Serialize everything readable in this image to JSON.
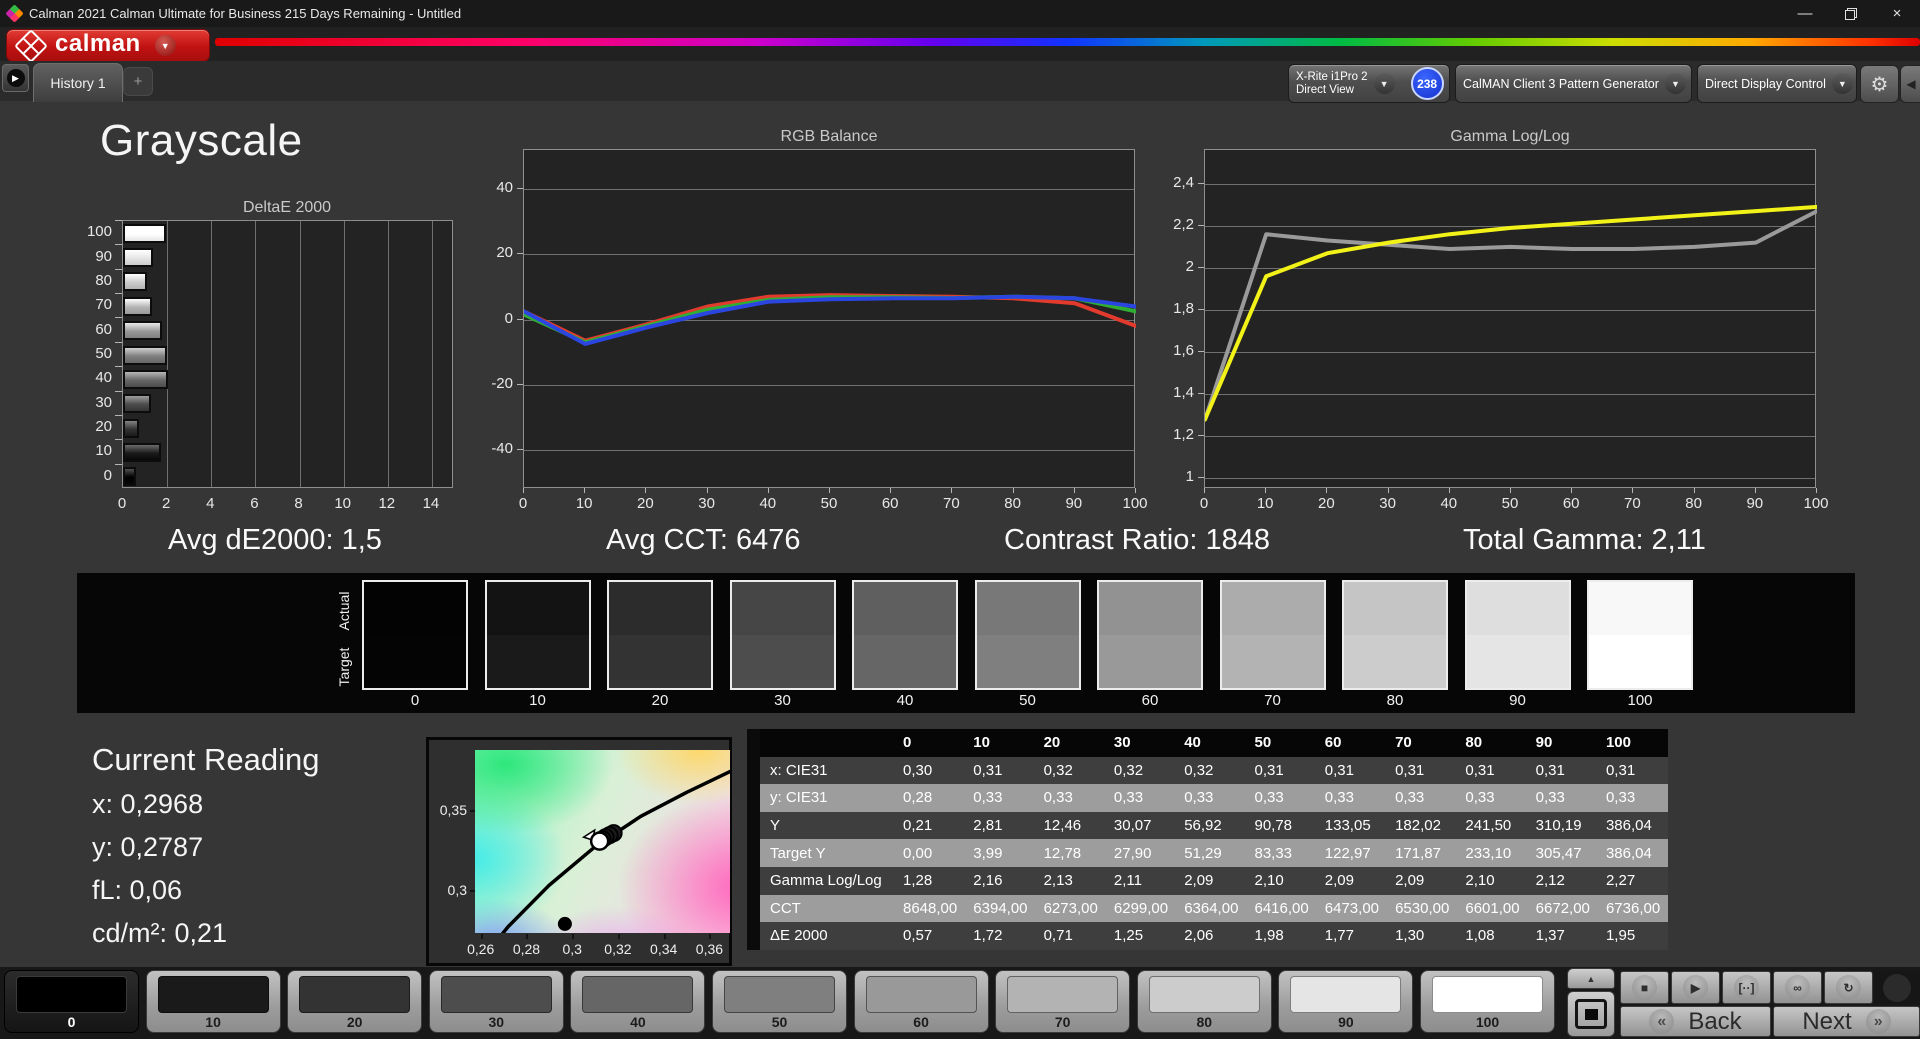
{
  "window": {
    "title": "Calman 2021 Calman Ultimate for Business 215 Days Remaining  - Untitled",
    "controls": [
      "minimize",
      "restore",
      "close"
    ]
  },
  "brand": {
    "logo_text": "calman"
  },
  "tabs": {
    "history": "History 1",
    "add": "+"
  },
  "toolbar": {
    "meter": {
      "line1": "X-Rite i1Pro 2",
      "line2": "Direct View",
      "badge": "238",
      "stripe_color": "#2ed52e"
    },
    "pattern_generator": {
      "label": "CalMAN Client 3 Pattern Generator",
      "stripe_color": "#2ed52e"
    },
    "display_control": {
      "label": "Direct Display Control",
      "stripe_color": "#f2e200"
    }
  },
  "page": {
    "title": "Grayscale"
  },
  "summary": [
    "Avg dE2000: 1,5",
    "Avg CCT: 6476",
    "Contrast Ratio: 1848",
    "Total Gamma: 2,11"
  ],
  "chart_data": [
    {
      "type": "bar",
      "orientation": "horizontal",
      "title": "DeltaE 2000",
      "categories": [
        100,
        90,
        80,
        70,
        60,
        50,
        40,
        30,
        20,
        10,
        0
      ],
      "values": [
        1.95,
        1.37,
        1.08,
        1.3,
        1.77,
        1.98,
        2.06,
        1.25,
        0.71,
        1.72,
        0.57
      ],
      "xlim": [
        0,
        15
      ],
      "x_ticks": [
        0,
        2,
        4,
        6,
        8,
        10,
        12,
        14
      ],
      "grid": "vertical"
    },
    {
      "type": "line",
      "title": "RGB Balance",
      "x": [
        0,
        10,
        20,
        30,
        40,
        50,
        60,
        70,
        80,
        90,
        100
      ],
      "x_ticks": [
        0,
        10,
        20,
        30,
        40,
        50,
        60,
        70,
        80,
        90,
        100
      ],
      "ylim": [
        -52,
        52
      ],
      "y_ticks": [
        40,
        20,
        0,
        -20,
        -40
      ],
      "y_tick_labels": [
        "40",
        "20",
        "0",
        "-20",
        "-40"
      ],
      "series": [
        {
          "name": "red",
          "color": "#e23b2e",
          "values": [
            2.5,
            -6.5,
            -1.5,
            4.0,
            7.0,
            7.5,
            7.2,
            7.0,
            6.5,
            5.0,
            -2.0
          ]
        },
        {
          "name": "green",
          "color": "#2fae33",
          "values": [
            1.5,
            -7.0,
            -2.0,
            3.0,
            6.0,
            6.8,
            6.8,
            6.6,
            7.0,
            6.5,
            2.5
          ]
        },
        {
          "name": "blue",
          "color": "#2b46e0",
          "values": [
            2.5,
            -7.5,
            -2.5,
            2.0,
            5.5,
            6.2,
            6.5,
            6.5,
            7.0,
            6.5,
            4.0
          ]
        }
      ]
    },
    {
      "type": "line",
      "title": "Gamma Log/Log",
      "x": [
        0,
        10,
        20,
        30,
        40,
        50,
        60,
        70,
        80,
        90,
        100
      ],
      "x_ticks": [
        0,
        10,
        20,
        30,
        40,
        50,
        60,
        70,
        80,
        90,
        100
      ],
      "ylim": [
        0.95,
        2.56
      ],
      "y_ticks": [
        2.4,
        2.2,
        2.0,
        1.8,
        1.6,
        1.4,
        1.2,
        1.0
      ],
      "y_tick_labels": [
        "2,4",
        "2,2",
        "2",
        "1,8",
        "1,6",
        "1,4",
        "1,2",
        "1"
      ],
      "series": [
        {
          "name": "measured",
          "color": "#9a9a9a",
          "values": [
            1.28,
            2.16,
            2.13,
            2.11,
            2.09,
            2.1,
            2.09,
            2.09,
            2.1,
            2.12,
            2.27
          ]
        },
        {
          "name": "target",
          "color": "#f2f219",
          "values": [
            1.28,
            1.96,
            2.07,
            2.12,
            2.16,
            2.19,
            2.21,
            2.23,
            2.25,
            2.27,
            2.29
          ]
        }
      ]
    },
    {
      "type": "scatter",
      "name": "cie-chromaticity",
      "xlim": [
        0.2575,
        0.369
      ],
      "ylim": [
        0.273,
        0.3875
      ],
      "x_tick_values": [
        0.26,
        0.28,
        0.3,
        0.32,
        0.34,
        0.36
      ],
      "x_tick_labels": [
        "0,26",
        "0,28",
        "0,3",
        "0,32",
        "0,34",
        "0,36"
      ],
      "y_tick_values": [
        0.35,
        0.3
      ],
      "y_tick_labels": [
        "0,35",
        "0,3"
      ],
      "locus": [
        [
          0.258,
          0.252
        ],
        [
          0.272,
          0.277
        ],
        [
          0.29,
          0.303
        ],
        [
          0.31,
          0.327
        ],
        [
          0.33,
          0.346
        ],
        [
          0.35,
          0.361
        ],
        [
          0.369,
          0.374
        ]
      ],
      "cluster": [
        0.312,
        0.3305
      ],
      "current_point": [
        0.2968,
        0.2787
      ]
    }
  ],
  "swatch_strip": {
    "actual_label": "Actual",
    "target_label": "Target",
    "levels": [
      0,
      10,
      20,
      30,
      40,
      50,
      60,
      70,
      80,
      90,
      100
    ]
  },
  "current_reading": {
    "title": "Current Reading",
    "lines": [
      "x: 0,2968",
      "y: 0,2787",
      "fL: 0,06",
      "cd/m²: 0,21"
    ]
  },
  "table": {
    "columns": [
      "0",
      "10",
      "20",
      "30",
      "40",
      "50",
      "60",
      "70",
      "80",
      "90",
      "100"
    ],
    "rows": [
      {
        "label": "x: CIE31",
        "values": [
          "0,30",
          "0,31",
          "0,32",
          "0,32",
          "0,32",
          "0,31",
          "0,31",
          "0,31",
          "0,31",
          "0,31",
          "0,31"
        ]
      },
      {
        "label": "y: CIE31",
        "values": [
          "0,28",
          "0,33",
          "0,33",
          "0,33",
          "0,33",
          "0,33",
          "0,33",
          "0,33",
          "0,33",
          "0,33",
          "0,33"
        ]
      },
      {
        "label": "Y",
        "values": [
          "0,21",
          "2,81",
          "12,46",
          "30,07",
          "56,92",
          "90,78",
          "133,05",
          "182,02",
          "241,50",
          "310,19",
          "386,04"
        ]
      },
      {
        "label": "Target Y",
        "values": [
          "0,00",
          "3,99",
          "12,78",
          "27,90",
          "51,29",
          "83,33",
          "122,97",
          "171,87",
          "233,10",
          "305,47",
          "386,04"
        ]
      },
      {
        "label": "Gamma Log/Log",
        "values": [
          "1,28",
          "2,16",
          "2,13",
          "2,11",
          "2,09",
          "2,10",
          "2,09",
          "2,09",
          "2,10",
          "2,12",
          "2,27"
        ]
      },
      {
        "label": "CCT",
        "values": [
          "8648,00",
          "6394,00",
          "6273,00",
          "6299,00",
          "6364,00",
          "6416,00",
          "6473,00",
          "6530,00",
          "6601,00",
          "6672,00",
          "6736,00"
        ]
      },
      {
        "label": "ΔE 2000",
        "values": [
          "0,57",
          "1,72",
          "0,71",
          "1,25",
          "2,06",
          "1,98",
          "1,77",
          "1,30",
          "1,08",
          "1,37",
          "1,95"
        ]
      }
    ]
  },
  "bottom_bar": {
    "patch_levels": [
      0,
      10,
      20,
      30,
      40,
      50,
      60,
      70,
      80,
      90,
      100
    ],
    "selected_patch": 0,
    "transport": [
      "stop",
      "play",
      "loop-range",
      "infinity",
      "refresh"
    ],
    "window_toggle": [
      "chevron-up",
      "pattern-window"
    ],
    "back_label": "Back",
    "next_label": "Next"
  }
}
